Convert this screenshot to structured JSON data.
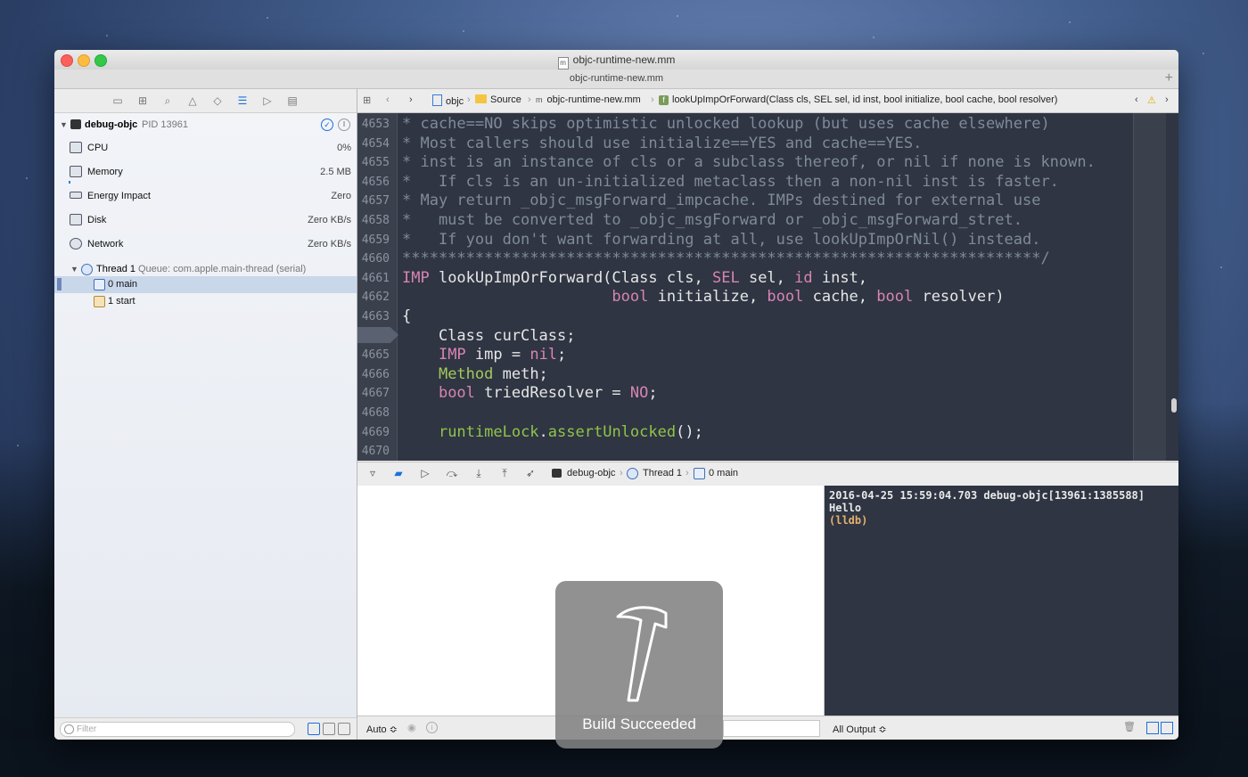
{
  "window": {
    "title": "objc-runtime-new.mm",
    "tab_title": "objc-runtime-new.mm"
  },
  "navigator": {
    "process": {
      "name": "debug-objc",
      "pid": "PID 13961"
    },
    "gauges": [
      {
        "label": "CPU",
        "value": "0%",
        "icon": "cpu-icon"
      },
      {
        "label": "Memory",
        "value": "2.5 MB",
        "icon": "memory-icon"
      },
      {
        "label": "Energy Impact",
        "value": "Zero",
        "icon": "energy-icon"
      },
      {
        "label": "Disk",
        "value": "Zero KB/s",
        "icon": "disk-icon"
      },
      {
        "label": "Network",
        "value": "Zero KB/s",
        "icon": "network-icon"
      }
    ],
    "thread": {
      "name": "Thread 1",
      "queue": "Queue: com.apple.main-thread (serial)"
    },
    "frames": [
      {
        "label": "0 main",
        "selected": true
      },
      {
        "label": "1 start",
        "selected": false
      }
    ],
    "filter_placeholder": "Filter"
  },
  "jump_bar": {
    "items": [
      "objc",
      "Source",
      "objc-runtime-new.mm",
      "lookUpImpOrForward(Class cls, SEL sel, id inst, bool initialize, bool cache, bool resolver)"
    ]
  },
  "editor": {
    "lines": [
      {
        "n": "4653",
        "text": "* cache==NO skips optimistic unlocked lookup (but uses cache elsewhere)"
      },
      {
        "n": "4654",
        "text": "* Most callers should use initialize==YES and cache==YES."
      },
      {
        "n": "4655",
        "text": "* inst is an instance of cls or a subclass thereof, or nil if none is known."
      },
      {
        "n": "4656",
        "text": "*   If cls is an un-initialized metaclass then a non-nil inst is faster."
      },
      {
        "n": "4657",
        "text": "* May return _objc_msgForward_impcache. IMPs destined for external use"
      },
      {
        "n": "4658",
        "text": "*   must be converted to _objc_msgForward or _objc_msgForward_stret."
      },
      {
        "n": "4659",
        "text": "*   If you don't want forwarding at all, use lookUpImpOrNil() instead."
      },
      {
        "n": "4660",
        "text": "**********************************************************************/"
      },
      {
        "n": "4661",
        "text": "IMP lookUpImpOrForward(Class cls, SEL sel, id inst,"
      },
      {
        "n": "4662",
        "text": "                       bool initialize, bool cache, bool resolver)"
      },
      {
        "n": "4663",
        "text": "{"
      },
      {
        "n": "",
        "text": "    Class curClass;"
      },
      {
        "n": "4665",
        "text": "    IMP imp = nil;"
      },
      {
        "n": "4666",
        "text": "    Method meth;"
      },
      {
        "n": "4667",
        "text": "    bool triedResolver = NO;"
      },
      {
        "n": "4668",
        "text": ""
      },
      {
        "n": "4669",
        "text": "    runtimeLock.assertUnlocked();"
      },
      {
        "n": "4670",
        "text": ""
      }
    ]
  },
  "debug_bar": {
    "process": "debug-objc",
    "thread": "Thread 1",
    "frame": "0 main"
  },
  "console": {
    "lines": [
      "2016-04-25 15:59:04.703 debug-objc[13961:1385588]",
      "Hello",
      "(lldb)"
    ]
  },
  "bottom_bar": {
    "variables_mode": "Auto ≎",
    "output_mode": "All Output ≎"
  },
  "hud": {
    "text": "Build Succeeded"
  }
}
